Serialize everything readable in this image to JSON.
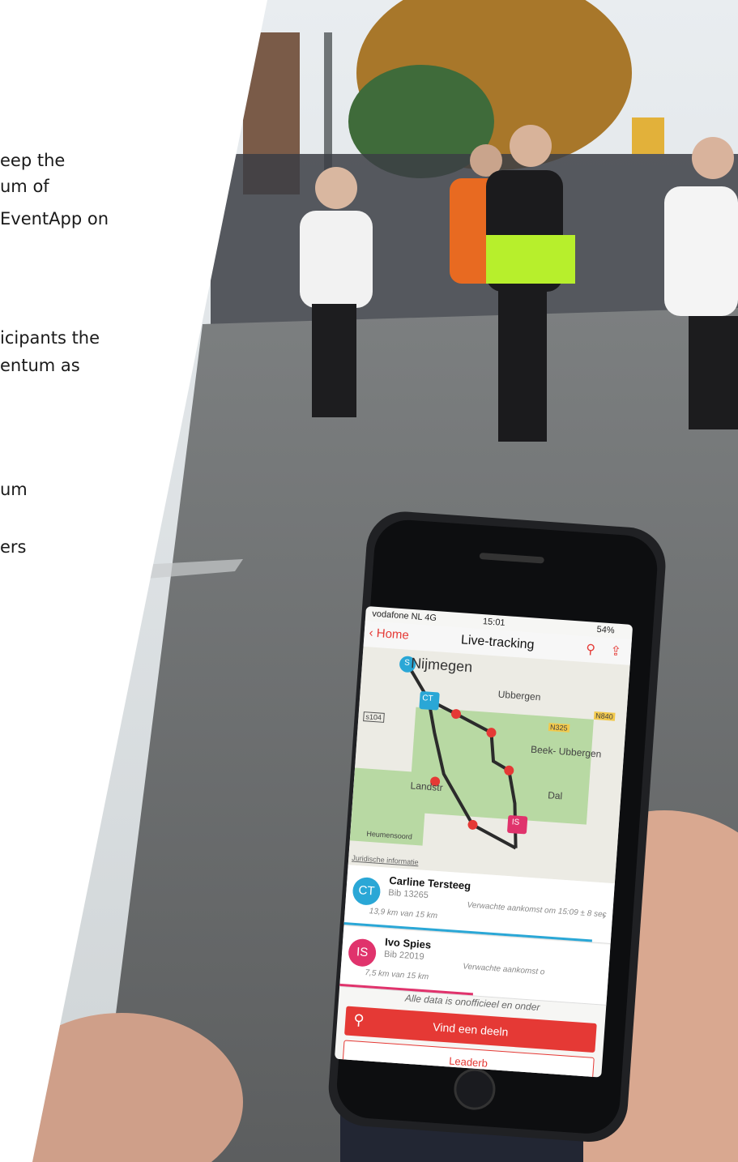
{
  "copy_lines": [
    "eep the",
    "um of",
    "EventApp on",
    "icipants the",
    "entum as",
    "um",
    "ers"
  ],
  "status_bar": {
    "carrier": "vodafone NL  4G",
    "time": "15:01",
    "battery": "54%"
  },
  "nav": {
    "back_label": "Home",
    "title": "Live-tracking",
    "search_icon": "search-icon",
    "share_icon": "share-icon"
  },
  "map": {
    "labels": {
      "city": "Nijmegen",
      "ubbergen": "Ubbergen",
      "beek": "Beek-\nUbbergen",
      "dal": "Dal",
      "landstr": "Landstr",
      "heumensoord": "Heumensoord",
      "road_s104": "s104",
      "road_n325": "N325",
      "road_n840": "N840"
    },
    "legal": "Juridische informatie",
    "markers": {
      "start": "S",
      "ct": "CT",
      "is": "IS"
    }
  },
  "participants": [
    {
      "initials": "CT",
      "name": "Carline Tersteeg",
      "bib": "Bib 13265",
      "eta": "Verwachte aankomst om 15:09 ± 8 sec",
      "distance": "13,9 km van 15 km",
      "progress": 0.93,
      "color": "#2aa7d6"
    },
    {
      "initials": "IS",
      "name": "Ivo Spies",
      "bib": "Bib 22019",
      "eta": "Verwachte aankomst o",
      "distance": "7,5 km van 15 km",
      "progress": 0.5,
      "color": "#e0336c"
    }
  ],
  "disclaimer": "Alle data is onofficieel en onder",
  "buttons": {
    "find": "Vind een deeln",
    "leaderboard": "Leaderb"
  },
  "colors": {
    "accent": "#e53935",
    "ct": "#2aa7d6",
    "is": "#e0336c"
  }
}
